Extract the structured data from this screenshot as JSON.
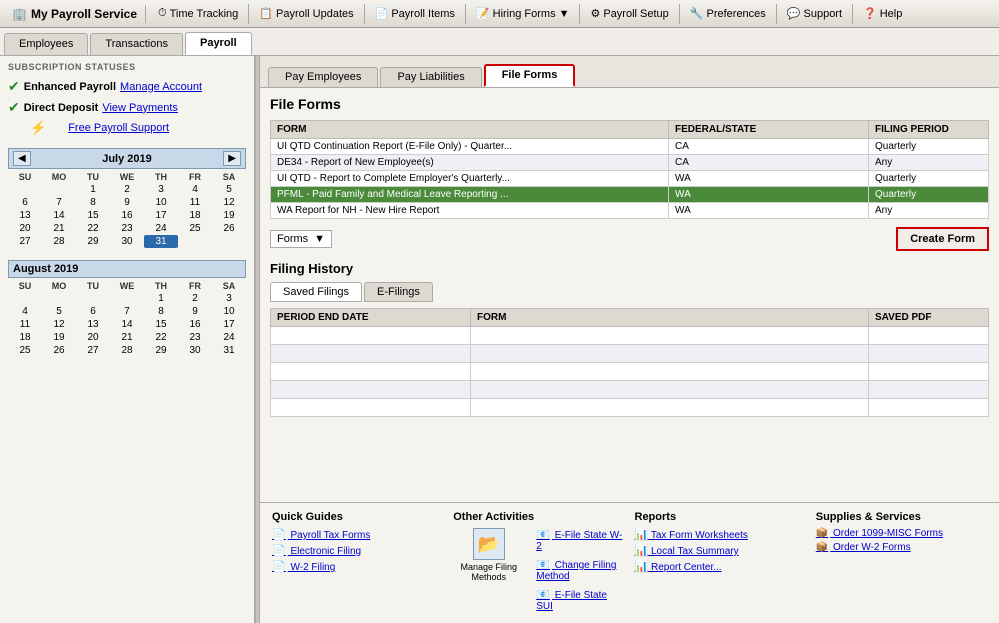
{
  "app": {
    "logo": "My Payroll Service",
    "logo_icon": "🏢"
  },
  "menu": {
    "items": [
      {
        "id": "time-tracking",
        "label": "Time Tracking",
        "icon": "⏱"
      },
      {
        "id": "payroll-updates",
        "label": "Payroll Updates",
        "icon": "📋"
      },
      {
        "id": "payroll-items",
        "label": "Payroll Items",
        "icon": "📄"
      },
      {
        "id": "hiring-forms",
        "label": "Hiring Forms",
        "icon": "📝",
        "has_arrow": true
      },
      {
        "id": "payroll-setup",
        "label": "Payroll Setup",
        "icon": "⚙"
      },
      {
        "id": "preferences",
        "label": "Preferences",
        "icon": "🔧"
      },
      {
        "id": "support",
        "label": "Support",
        "icon": "💬"
      },
      {
        "id": "help",
        "label": "Help",
        "icon": "❓"
      }
    ]
  },
  "main_tabs": [
    {
      "id": "employees",
      "label": "Employees",
      "active": false
    },
    {
      "id": "transactions",
      "label": "Transactions",
      "active": false
    },
    {
      "id": "payroll",
      "label": "Payroll",
      "active": true
    }
  ],
  "sub_tabs": [
    {
      "id": "pay-employees",
      "label": "Pay Employees",
      "active": false
    },
    {
      "id": "pay-liabilities",
      "label": "Pay Liabilities",
      "active": false
    },
    {
      "id": "file-forms",
      "label": "File Forms",
      "active": true
    }
  ],
  "sidebar": {
    "subscription_title": "SUBSCRIPTION STATUSES",
    "items": [
      {
        "id": "enhanced-payroll",
        "label": "Enhanced Payroll",
        "checked": true,
        "link": "Manage Account"
      },
      {
        "id": "direct-deposit",
        "label": "Direct Deposit",
        "checked": true,
        "link": "View Payments"
      }
    ],
    "free_support": "Free Payroll Support",
    "calendars": [
      {
        "month": "July 2019",
        "days_of_week": [
          "SU",
          "MO",
          "TU",
          "WE",
          "TH",
          "FR",
          "SA"
        ],
        "weeks": [
          [
            "",
            "",
            "1",
            "2",
            "3",
            "4",
            "5"
          ],
          [
            "6",
            "7",
            "8",
            "9",
            "10",
            "11",
            "12"
          ],
          [
            "13",
            "14",
            "15",
            "16",
            "17",
            "18",
            "19"
          ],
          [
            "20",
            "21",
            "22",
            "23",
            "24",
            "25",
            "26"
          ],
          [
            "27",
            "28",
            "29",
            "30",
            "31",
            "",
            ""
          ]
        ],
        "today": "31"
      },
      {
        "month": "August 2019",
        "days_of_week": [
          "SU",
          "MO",
          "TU",
          "WE",
          "TH",
          "FR",
          "SA"
        ],
        "weeks": [
          [
            "",
            "",
            "",
            "",
            "1",
            "2",
            "3"
          ],
          [
            "4",
            "5",
            "6",
            "7",
            "8",
            "9",
            "10"
          ],
          [
            "11",
            "12",
            "13",
            "14",
            "15",
            "16",
            "17"
          ],
          [
            "18",
            "19",
            "20",
            "21",
            "22",
            "23",
            "24"
          ],
          [
            "25",
            "26",
            "27",
            "28",
            "29",
            "30",
            "31"
          ]
        ],
        "today": ""
      }
    ]
  },
  "file_forms": {
    "section_title": "File Forms",
    "table_headers": [
      "FORM",
      "FEDERAL/STATE",
      "FILING PERIOD"
    ],
    "rows": [
      {
        "form": "UI QTD Continuation Report (E-File Only) - Quarter...",
        "state": "CA",
        "period": "Quarterly",
        "selected": false
      },
      {
        "form": "DE34 - Report of New Employee(s)",
        "state": "CA",
        "period": "Any",
        "selected": false
      },
      {
        "form": "UI QTD - Report to Complete Employer's Quarterly...",
        "state": "WA",
        "period": "Quarterly",
        "selected": false
      },
      {
        "form": "PFML - Paid Family and Medical Leave Reporting ...",
        "state": "WA",
        "period": "Quarterly",
        "selected": true
      },
      {
        "form": "WA Report for NH - New Hire Report",
        "state": "WA",
        "period": "Any",
        "selected": false
      }
    ],
    "forms_dropdown_label": "Forms",
    "create_form_label": "Create Form"
  },
  "filing_history": {
    "title": "Filing History",
    "tabs": [
      {
        "id": "saved-filings",
        "label": "Saved Filings",
        "active": true
      },
      {
        "id": "e-filings",
        "label": "E-Filings",
        "active": false
      }
    ],
    "table_headers": [
      "PERIOD END DATE",
      "FORM",
      "SAVED PDF"
    ],
    "rows": [
      {
        "period": "",
        "form": "",
        "pdf": ""
      },
      {
        "period": "",
        "form": "",
        "pdf": ""
      },
      {
        "period": "",
        "form": "",
        "pdf": ""
      },
      {
        "period": "",
        "form": "",
        "pdf": ""
      },
      {
        "period": "",
        "form": "",
        "pdf": ""
      }
    ]
  },
  "bottom": {
    "quick_guides": {
      "title": "Quick Guides",
      "links": [
        {
          "label": "Payroll Tax Forms",
          "icon": "pdf"
        },
        {
          "label": "Electronic Filing",
          "icon": "pdf"
        },
        {
          "label": "W-2 Filing",
          "icon": "pdf"
        }
      ]
    },
    "other_activities": {
      "title": "Other Activities",
      "icon_label": "Manage Filing Methods",
      "links": [
        {
          "label": "E-File State W-2",
          "icon": "efile"
        },
        {
          "label": "Change Filing Method",
          "icon": "efile"
        },
        {
          "label": "E-File State SUI",
          "icon": "efile"
        }
      ]
    },
    "reports": {
      "title": "Reports",
      "links": [
        {
          "label": "Tax Form Worksheets",
          "icon": "report"
        },
        {
          "label": "Local Tax Summary",
          "icon": "report"
        },
        {
          "label": "Report Center...",
          "icon": "report"
        }
      ]
    },
    "supplies": {
      "title": "Supplies & Services",
      "links": [
        {
          "label": "Order 1099-MISC Forms",
          "icon": "supply"
        },
        {
          "label": "Order W-2 Forms",
          "icon": "supply"
        }
      ]
    }
  }
}
